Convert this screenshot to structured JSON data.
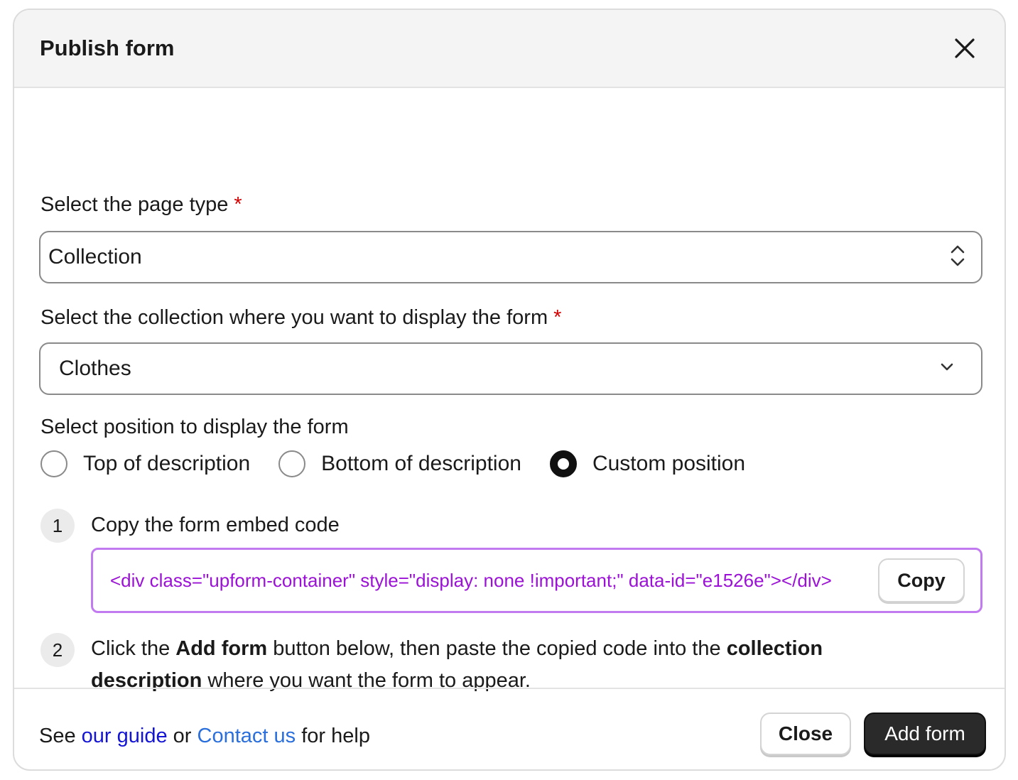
{
  "dialog": {
    "title": "Publish form"
  },
  "page_type": {
    "label": "Select the page type",
    "required_mark": "*",
    "value": "Collection"
  },
  "collection": {
    "label": "Select the collection where you want to display the form",
    "required_mark": "*",
    "value": "Clothes"
  },
  "position": {
    "label": "Select position to display the form",
    "options": [
      {
        "label": "Top of description",
        "checked": false
      },
      {
        "label": "Bottom of description",
        "checked": false
      },
      {
        "label": "Custom position",
        "checked": true
      }
    ]
  },
  "steps": {
    "step1": {
      "number": "1",
      "text": "Copy the form embed code",
      "code": "<div class=\"upform-container\" style=\"display: none !important;\" data-id=\"e1526e\"></div>",
      "copy_label": "Copy"
    },
    "step2": {
      "number": "2",
      "text_1": "Click the ",
      "bold_1": "Add form",
      "text_2": " button below, then paste the copied code into the ",
      "bold_2": "collection description",
      "text_3": " where you want the form to appear."
    }
  },
  "help": {
    "prefix": "See ",
    "guide_link": "our guide",
    "middle": " or ",
    "contact_link": "Contact us",
    "suffix": " for help"
  },
  "footer": {
    "close_label": "Close",
    "add_label": "Add form"
  },
  "colors": {
    "accent_code": "#9b12d6",
    "code_border": "#c27af0",
    "required": "#d40000",
    "link_guide": "#1414d4",
    "link_contact": "#2a6fdb",
    "primary_button": "#2a2a2a"
  }
}
